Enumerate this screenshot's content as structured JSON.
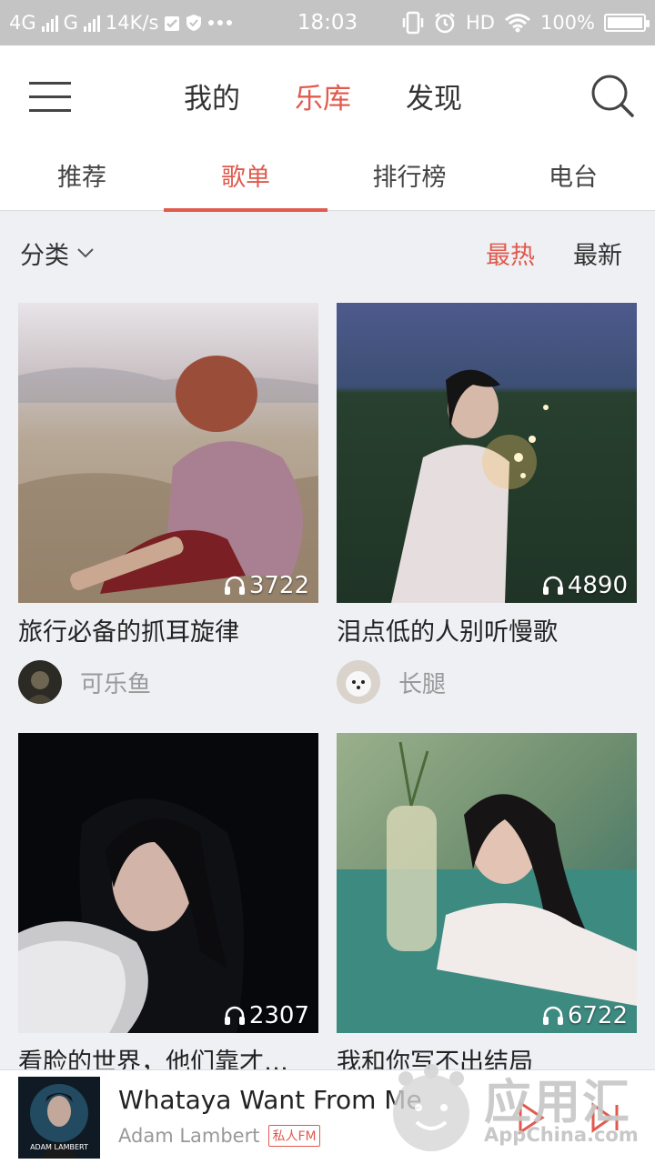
{
  "status_bar": {
    "network_1": "4G",
    "network_2": "G",
    "speed": "14K/s",
    "time": "18:03",
    "hd": "HD",
    "battery": "100%"
  },
  "top_nav": {
    "tabs": [
      {
        "label": "我的",
        "active": false
      },
      {
        "label": "乐库",
        "active": true
      },
      {
        "label": "发现",
        "active": false
      }
    ]
  },
  "sub_tabs": [
    {
      "label": "推荐",
      "active": false
    },
    {
      "label": "歌单",
      "active": true
    },
    {
      "label": "排行榜",
      "active": false
    },
    {
      "label": "电台",
      "active": false
    }
  ],
  "filter": {
    "category_label": "分类",
    "sort_hot": "最热",
    "sort_new": "最新",
    "active_sort": "最热"
  },
  "playlists": [
    {
      "title": "旅行必备的抓耳旋律",
      "plays": "3722",
      "creator": "可乐鱼"
    },
    {
      "title": "泪点低的人别听慢歌",
      "plays": "4890",
      "creator": "长腿"
    },
    {
      "title": "看脸的世界，他们靠才…",
      "plays": "2307",
      "creator": ""
    },
    {
      "title": "我和你写不出结局",
      "plays": "6722",
      "creator": ""
    }
  ],
  "player": {
    "song": "Whataya Want From Me",
    "artist": "Adam Lambert",
    "tag": "私人FM",
    "album_text": "ADAM LAMBERT"
  },
  "watermark": {
    "title": "应用汇",
    "subtitle": "AppChina.com"
  },
  "colors": {
    "accent": "#e05a4e",
    "background": "#eef0f3",
    "status_bar": "#c4c4c4"
  }
}
